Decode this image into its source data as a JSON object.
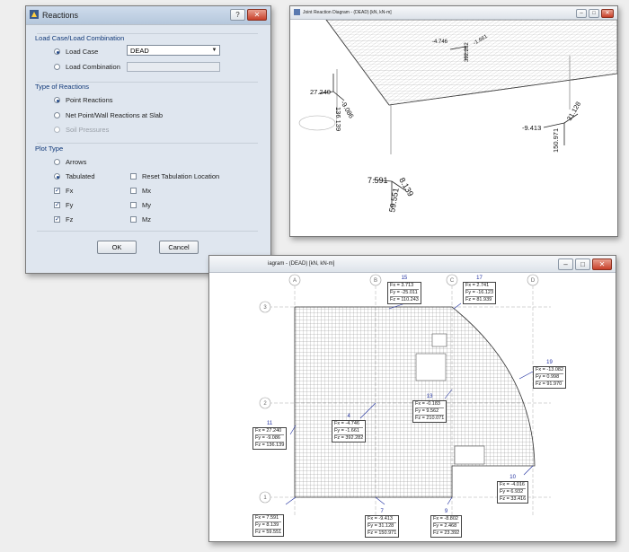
{
  "dialog": {
    "title": "Reactions",
    "help_label": "?",
    "close_label": "✕",
    "load_group": {
      "title": "Load Case/Load Combination",
      "load_case_label": "Load Case",
      "load_case_value": "DEAD",
      "load_combination_label": "Load Combination"
    },
    "reaction_group": {
      "title": "Type of Reactions",
      "point_label": "Point Reactions",
      "net_label": "Net Point/Wall Reactions at Slab",
      "soil_label": "Soil Pressures"
    },
    "plot_group": {
      "title": "Plot Type",
      "arrows_label": "Arrows",
      "tabulated_label": "Tabulated",
      "reset_label": "Reset Tabulation Location",
      "fx_label": "Fx",
      "fy_label": "Fy",
      "fz_label": "Fz",
      "mx_label": "Mx",
      "my_label": "My",
      "mz_label": "Mz"
    },
    "ok_label": "OK",
    "cancel_label": "Cancel"
  },
  "window_3d": {
    "title": "Joint Reaction Diagram  - (DEAD)  [kN, kN-m]",
    "labels": [
      {
        "text": "27.240"
      },
      {
        "text": "-9.086"
      },
      {
        "text": "136.139"
      },
      {
        "text": "-9.413"
      },
      {
        "text": "31.128"
      },
      {
        "text": "150.971"
      },
      {
        "text": "7.591"
      },
      {
        "text": "8.139"
      },
      {
        "text": "59.551"
      },
      {
        "text": "-4.746"
      },
      {
        "text": "-1.661"
      },
      {
        "text": "392.282"
      }
    ]
  },
  "window_plan": {
    "title": "iagram   - (DEAD)  [kN, kN-m]",
    "grid_cols": [
      "A",
      "B",
      "C",
      "D"
    ],
    "grid_rows": [
      "3",
      "2",
      "1"
    ],
    "reactions": [
      {
        "id": "15",
        "fx": "Fx = 3.713",
        "fy": "Fy = -25.011",
        "fz": "Fz = 110.243"
      },
      {
        "id": "17",
        "fx": "Fx = 2.741",
        "fy": "Fy = -16.123",
        "fz": "Fz = 81.939"
      },
      {
        "id": "19",
        "fx": "Fx = -13.082",
        "fy": "Fy = 0.998",
        "fz": "Fz = 91.970"
      },
      {
        "id": "11",
        "fx": "Fx = 27.240",
        "fy": "Fy = -9.086",
        "fz": "Fz = 136.139"
      },
      {
        "id": "4",
        "fx": "Fx = -4.746",
        "fy": "Fy = -1.661",
        "fz": "Fz = 392.282"
      },
      {
        "id": "13",
        "fx": "Fx = -0.183",
        "fy": "Fy = 9.562",
        "fz": "Fz = 210.071"
      },
      {
        "id": "10",
        "fx": "Fx = -4.016",
        "fy": "Fy = 6.932",
        "fz": "Fz = 33.416"
      },
      {
        "id": "",
        "fx": "Fx = 7.591",
        "fy": "Fy = 8.139",
        "fz": "Fz = 59.551"
      },
      {
        "id": "7",
        "fx": "Fx = -9.413",
        "fy": "Fy = 31.128",
        "fz": "Fz = 150.971"
      },
      {
        "id": "9",
        "fx": "Fx = -8.802",
        "fy": "Fy = 2.468",
        "fz": "Fz = 23.392"
      }
    ]
  },
  "colors": {
    "accent": "#244a8a",
    "label_blue": "#2030a0"
  }
}
